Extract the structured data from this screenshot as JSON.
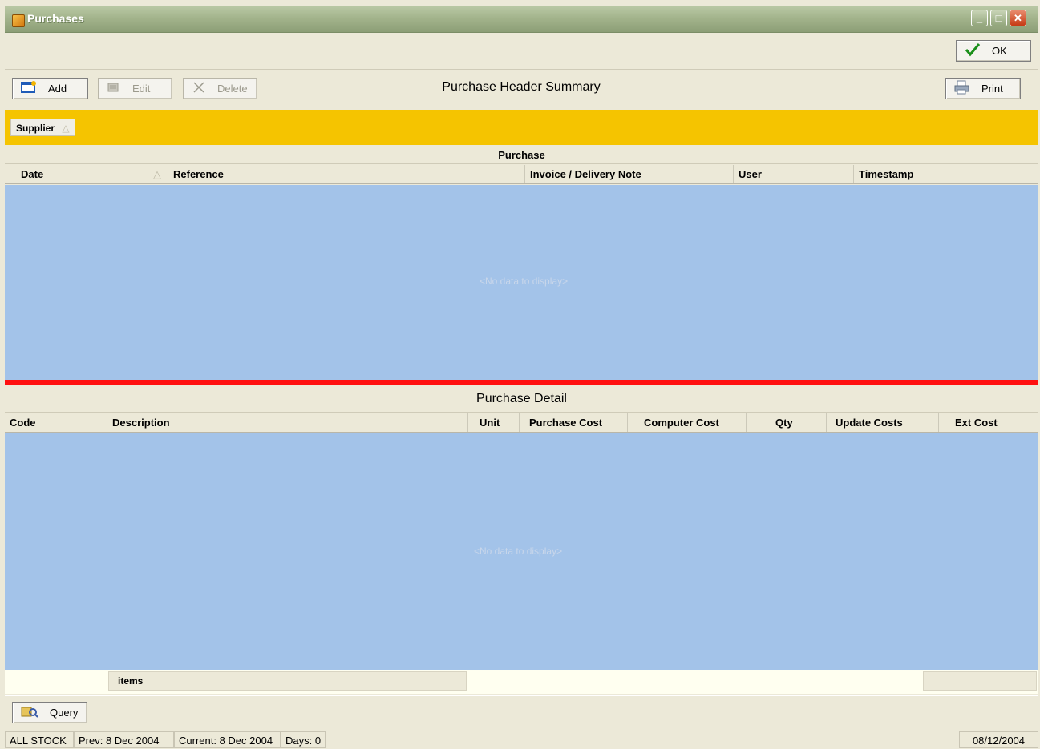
{
  "window": {
    "title": "Purchases",
    "controls": {
      "minimize": "_",
      "maximize": "□",
      "close": "✕"
    }
  },
  "toolbar_top": {
    "ok_label": "OK"
  },
  "toolbar": {
    "add_label": "Add",
    "edit_label": "Edit",
    "delete_label": "Delete",
    "print_label": "Print",
    "heading": "Purchase Header Summary"
  },
  "header_grid": {
    "group_by": "Supplier",
    "band_title": "Purchase",
    "columns": [
      "Date",
      "Reference",
      "Invoice / Delivery Note",
      "User",
      "Timestamp"
    ],
    "empty_text": "<No data to display>"
  },
  "detail_grid": {
    "title": "Purchase Detail",
    "columns": [
      "Code",
      "Description",
      "Unit",
      "Purchase Cost",
      "Computer Cost",
      "Qty",
      "Update Costs",
      "Ext Cost"
    ],
    "empty_text": "<No data to display>",
    "footer_items_label": "items"
  },
  "query_button": {
    "label": "Query"
  },
  "status": {
    "store": "ALL STOCK",
    "prev": "Prev: 8 Dec 2004",
    "current": "Current: 8 Dec 2004",
    "days": "Days: 0",
    "date": "08/12/2004"
  },
  "colors": {
    "group_band": "#f5c400",
    "grid_background": "#a3c3e9",
    "splitter": "#ff1010",
    "chrome": "#ece9d8"
  }
}
